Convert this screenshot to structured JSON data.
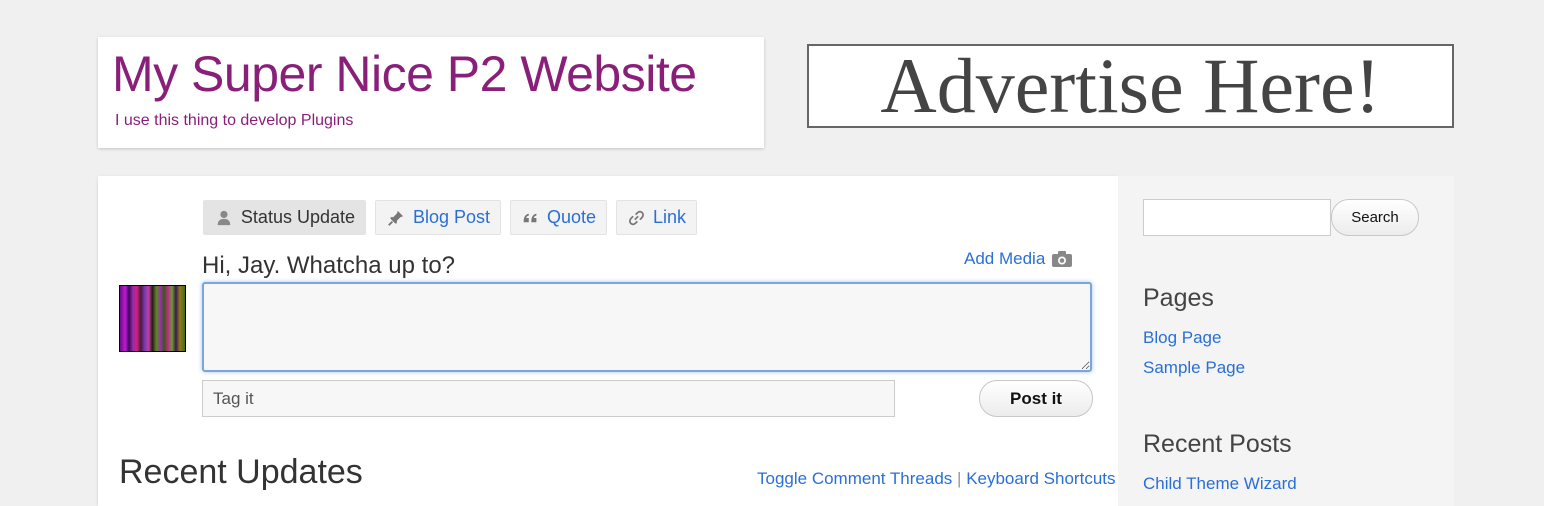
{
  "header": {
    "site_title": "My Super Nice P2 Website",
    "site_description": "I use this thing to develop Plugins"
  },
  "ad": {
    "text": "Advertise Here!"
  },
  "post_tabs": [
    {
      "label": "Status Update",
      "icon": "person-icon",
      "active": true
    },
    {
      "label": "Blog Post",
      "icon": "pin-icon",
      "active": false
    },
    {
      "label": "Quote",
      "icon": "quote-icon",
      "active": false
    },
    {
      "label": "Link",
      "icon": "link-icon",
      "active": false
    }
  ],
  "postbox": {
    "greeting": "Hi, Jay. Whatcha up to?",
    "add_media_label": "Add Media",
    "status_value": "",
    "tag_placeholder": "Tag it",
    "post_button_label": "Post it"
  },
  "recent": {
    "title": "Recent Updates",
    "toggle_comments": "Toggle Comment Threads",
    "separator": "|",
    "keyboard_shortcuts": "Keyboard Shortcuts"
  },
  "sidebar": {
    "search_button_label": "Search",
    "pages_title": "Pages",
    "pages": [
      "Blog Page",
      "Sample Page"
    ],
    "recent_posts_title": "Recent Posts",
    "recent_posts": [
      "Child Theme Wizard"
    ]
  },
  "colors": {
    "brand": "#8a1f7a",
    "link": "#2a6fd6",
    "focus_border": "#7aa6e0"
  }
}
